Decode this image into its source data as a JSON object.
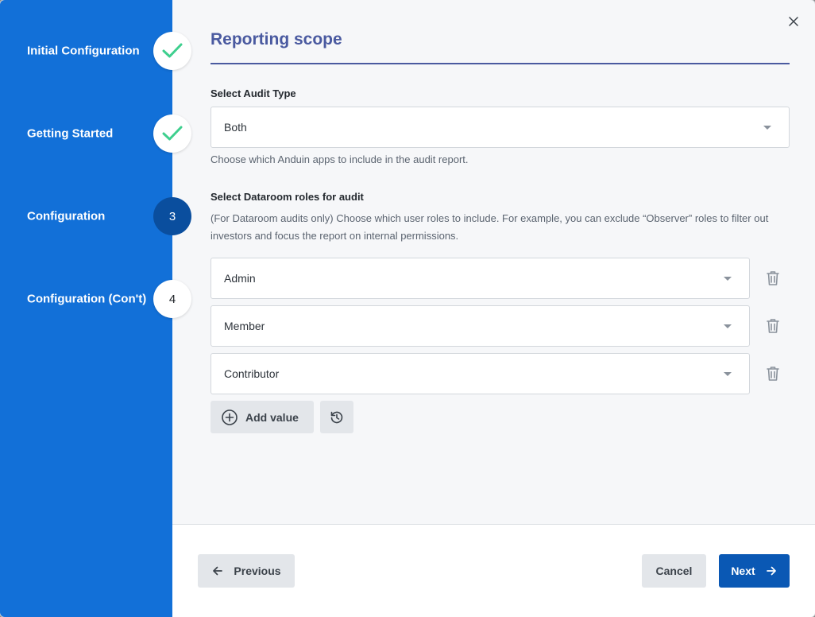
{
  "steps": [
    {
      "label": "Initial Configuration",
      "state": "done",
      "icon": "check-icon"
    },
    {
      "label": "Getting Started",
      "state": "done",
      "icon": "check-icon"
    },
    {
      "label": "Configuration",
      "state": "active",
      "number": "3"
    },
    {
      "label": "Configuration (Con't)",
      "state": "pending",
      "number": "4"
    }
  ],
  "page": {
    "title": "Reporting scope"
  },
  "audit_type": {
    "label": "Select Audit Type",
    "value": "Both",
    "help": "Choose which Anduin apps to include in the audit report."
  },
  "roles": {
    "label": "Select Dataroom roles for audit",
    "help": "(For Dataroom audits only) Choose which user roles to include. For example, you can exclude “Observer” roles to filter out investors and focus the report on internal permissions.",
    "items": [
      {
        "value": "Admin"
      },
      {
        "value": "Member"
      },
      {
        "value": "Contributor"
      }
    ],
    "add_label": "Add value"
  },
  "footer": {
    "previous_label": "Previous",
    "cancel_label": "Cancel",
    "next_label": "Next"
  },
  "colors": {
    "sidebar": "#1270d8",
    "active_step": "#0a4e9e",
    "check": "#3ecf8e",
    "title": "#4a5aa0",
    "primary_button": "#0a58b4"
  }
}
